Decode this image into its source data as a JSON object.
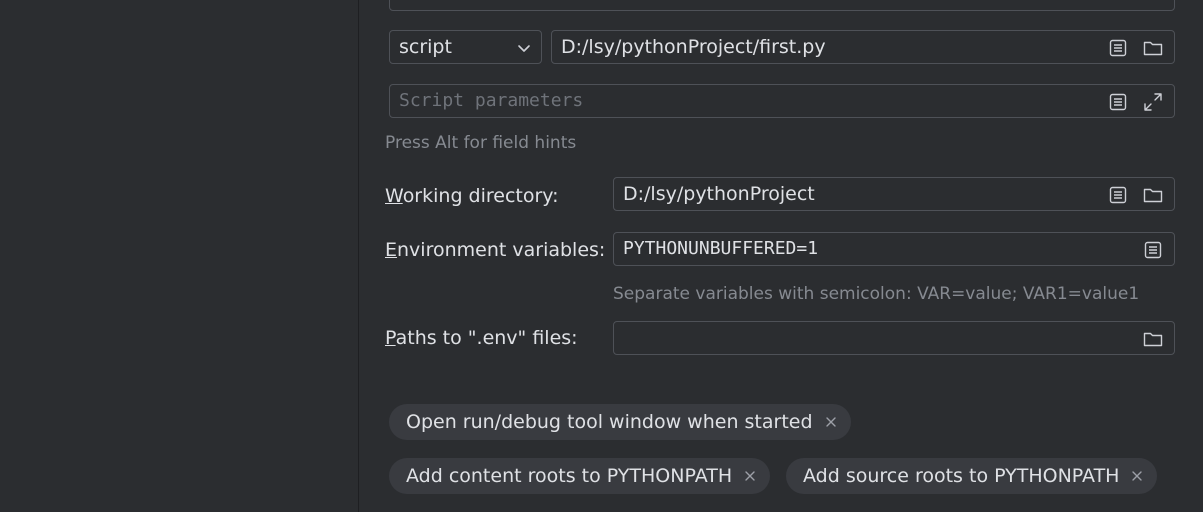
{
  "interpreter_options_input": {
    "value": ""
  },
  "script_target": {
    "type_value": "script",
    "path_value": "D:/lsy/pythonProject/first.py"
  },
  "script_params": {
    "placeholder": "Script parameters"
  },
  "field_hint": "Press Alt for field hints",
  "working_directory": {
    "label_prefix": "W",
    "label_rest": "orking directory:",
    "value": "D:/lsy/pythonProject"
  },
  "environment_variables": {
    "label_prefix": "E",
    "label_rest": "nvironment variables:",
    "value": "PYTHONUNBUFFERED=1",
    "hint": "Separate variables with semicolon: VAR=value; VAR1=value1"
  },
  "env_files": {
    "label_prefix": "P",
    "label_rest": "aths to \".env\" files:",
    "value": ""
  },
  "options": [
    {
      "label": "Open run/debug tool window when started"
    },
    {
      "label": "Add content roots to PYTHONPATH"
    },
    {
      "label": "Add source roots to PYTHONPATH"
    }
  ],
  "icons": {
    "edit": "list-edit-icon",
    "folder": "folder-icon",
    "expand": "expand-icon",
    "close": "close-icon",
    "chevron": "chevron-down-icon"
  }
}
